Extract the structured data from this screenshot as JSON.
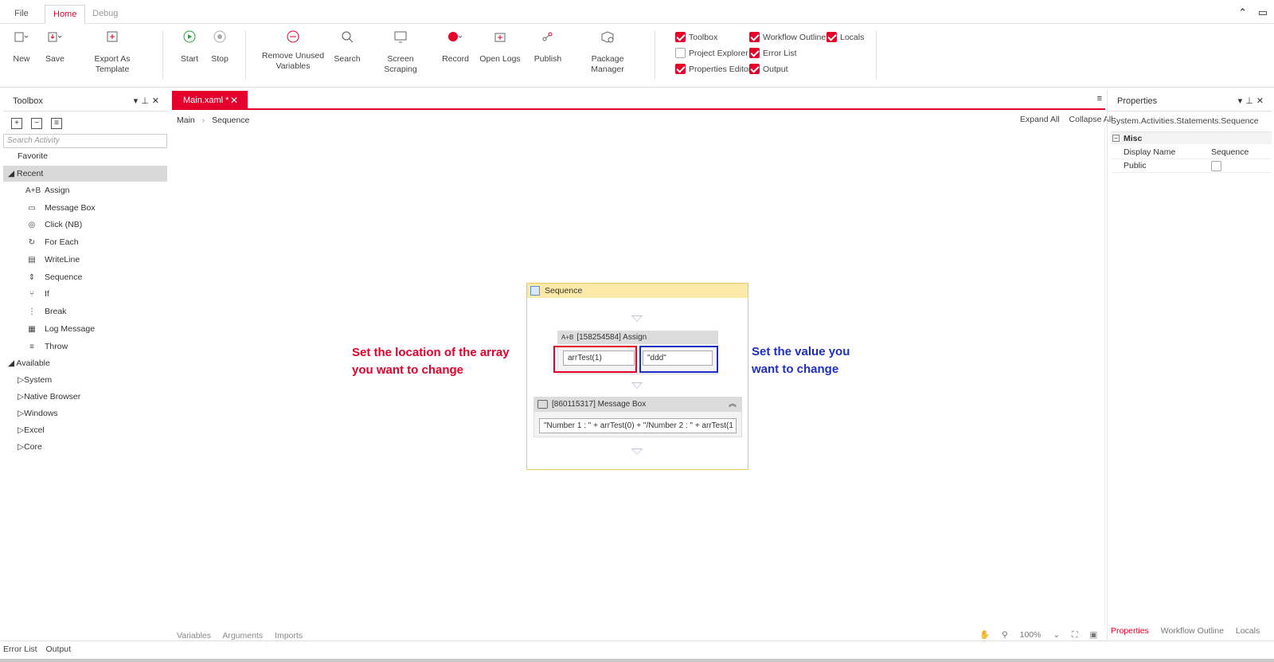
{
  "menu": {
    "file": "File",
    "home": "Home",
    "debug": "Debug"
  },
  "window_controls": {
    "collapse": "⌃",
    "panel": "▭"
  },
  "ribbon": {
    "new": "New",
    "save": "Save",
    "export": "Export As Template",
    "start": "Start",
    "stop": "Stop",
    "remove_unused_1": "Remove Unused",
    "remove_unused_2": "Variables",
    "search": "Search",
    "screen_scraping": "Screen Scraping",
    "record": "Record",
    "open_logs": "Open Logs",
    "publish": "Publish",
    "package_manager": "Package Manager",
    "panels": {
      "toolbox": "Toolbox",
      "workflow_outline": "Workflow Outline",
      "locals": "Locals",
      "project_explorer": "Project Explorer",
      "error_list": "Error List",
      "properties_editor": "Properties Editor",
      "output": "Output"
    },
    "panels_checked": {
      "toolbox": true,
      "workflow_outline": true,
      "locals": true,
      "project_explorer": false,
      "error_list": true,
      "properties_editor": true,
      "output": true
    }
  },
  "toolbox": {
    "title": "Toolbox",
    "search_placeholder": "Search Activity",
    "favorite": "Favorite",
    "recent": "Recent",
    "recent_items": [
      "Assign",
      "Message Box",
      "Click (NB)",
      "For Each",
      "WriteLine",
      "Sequence",
      "If",
      "Break",
      "Log Message",
      "Throw"
    ],
    "available": "Available",
    "available_items": [
      "System",
      "Native Browser",
      "Windows",
      "Excel",
      "Core"
    ]
  },
  "designer": {
    "tab": "Main.xaml *",
    "breadcrumb_root": "Main",
    "breadcrumb_child": "Sequence",
    "expand_all": "Expand All",
    "collapse_all": "Collapse All",
    "sequence_title": "Sequence",
    "assign_title": "[158254584] Assign",
    "assign_to": "arrTest(1)",
    "assign_value": "\"ddd\"",
    "msgbox_title": "[860115317] Message Box",
    "msgbox_text": "\"Number 1 : \" + arrTest(0) + \"/Number 2 : \" + arrTest(1",
    "annotation_left_1": "Set the location of the array",
    "annotation_left_2": "you want to change",
    "annotation_right_1": "Set the value you",
    "annotation_right_2": "want to change",
    "footer": {
      "variables": "Variables",
      "arguments": "Arguments",
      "imports": "Imports"
    },
    "zoom": "100%"
  },
  "properties": {
    "title": "Properties",
    "type": "System.Activities.Statements.Sequence",
    "category": "Misc",
    "display_name_label": "Display Name",
    "display_name_value": "Sequence",
    "public_label": "Public",
    "tabs": {
      "properties": "Properties",
      "workflow_outline": "Workflow Outline",
      "locals": "Locals"
    }
  },
  "statusbar": {
    "error_list": "Error List",
    "output": "Output"
  },
  "colors": {
    "accent": "#e4002b",
    "annotation_blue": "#1d2fc4",
    "sequence_header": "#fbe9a9"
  }
}
